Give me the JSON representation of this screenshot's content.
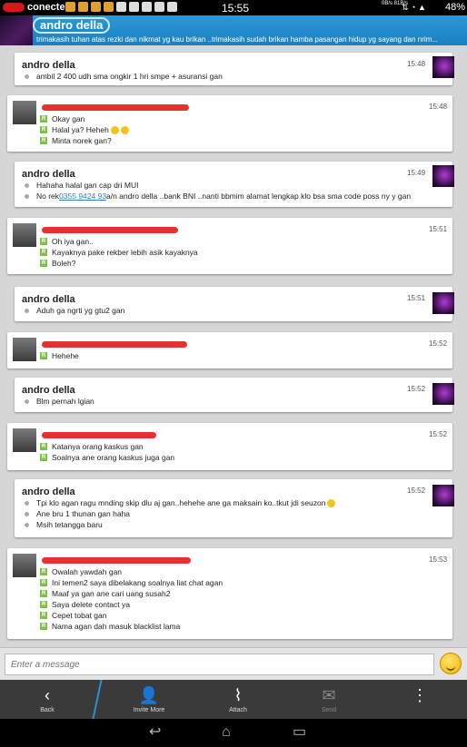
{
  "statusbar": {
    "carrier": "conected",
    "time": "15:55",
    "speed": "0B/s 81B/s",
    "battery": "48%"
  },
  "header": {
    "contact_name": "andro della",
    "status_text": "trimakasih tuhan atas rezki dan nikmat yg kau brikan   ..trimakasih sudah brikan hamba pasangan hidup yg sayang dan nrim..."
  },
  "messages": [
    {
      "sender": "andro della",
      "time": "15:48",
      "lines": [
        "ambil 2 400 udh sma ongkir 1 hri smpe + asuransi gan"
      ]
    },
    {
      "sender": "",
      "time": "15:48",
      "lines": [
        "Okay gan",
        "Halal ya? Heheh",
        "Minta norek gan?"
      ]
    },
    {
      "sender": "andro della",
      "time": "15:49",
      "lines": [
        "Hahaha halal gan cap dri MUI"
      ],
      "rek_prefix": "No rek ",
      "rek_number": "0355 9424 93",
      "rek_suffix": " a/n andro della ..bank BNI  ..nanti bbmim alamat lengkap klo bsa sma code poss ny y gan"
    },
    {
      "sender": "",
      "time": "15:51",
      "lines": [
        "Oh iya gan..",
        "Kayaknya pake rekber lebih asik kayaknya",
        "Boleh?"
      ]
    },
    {
      "sender": "andro della",
      "time": "15:51",
      "lines": [
        "Aduh ga ngrti yg gtu2 gan"
      ]
    },
    {
      "sender": "",
      "time": "15:52",
      "lines": [
        "Hehehe"
      ]
    },
    {
      "sender": "andro della",
      "time": "15:52",
      "lines": [
        "Blm pernah lgian"
      ]
    },
    {
      "sender": "",
      "time": "15:52",
      "lines": [
        "Katanya orang kaskus gan",
        "Soalnya ane orang kaskus juga gan"
      ]
    },
    {
      "sender": "andro della",
      "time": "15:52",
      "lines": [
        "Tpi klo agan ragu mnding skip dlu aj gan..hehehe ane ga maksain ko..tkut jdi seuzon",
        "Ane bru 1 thunan gan haha",
        "Msih tetangga baru"
      ]
    },
    {
      "sender": "",
      "time": "15:53",
      "lines": [
        "Owalah yawdah gan",
        "Ini temen2 saya dibelakang soalnya liat chat agan",
        "Maaf ya gan ane cari uang susah2",
        "Saya delete contact ya",
        "Cepet tobat gan",
        "Nama agan dah masuk blacklist lama"
      ]
    }
  ],
  "input": {
    "placeholder": "Enter a message"
  },
  "actions": {
    "back": "Back",
    "invite": "Invite More",
    "attach": "Attach",
    "send": "Send"
  },
  "colors": {
    "header": "#1b7fc0",
    "read_badge": "#7cc24a",
    "redaction": "#e31b1b"
  }
}
